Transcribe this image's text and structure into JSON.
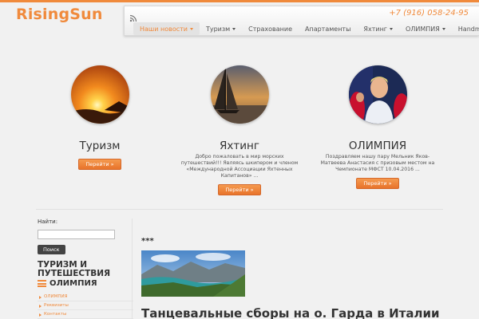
{
  "header": {
    "logo": "RisingSun",
    "phone": "+7 (916) 058-24-95",
    "accent_color": "#f08a3c",
    "icons": [
      "rss-icon"
    ]
  },
  "nav": {
    "items": [
      {
        "label": "Наши новости",
        "dropdown": true,
        "active": true
      },
      {
        "label": "Туризм",
        "dropdown": true,
        "active": false
      },
      {
        "label": "Страхование",
        "dropdown": false,
        "active": false
      },
      {
        "label": "Апартаменты",
        "dropdown": false,
        "active": false
      },
      {
        "label": "Яхтинг",
        "dropdown": true,
        "active": false
      },
      {
        "label": "ОЛИМПИЯ",
        "dropdown": true,
        "active": false
      },
      {
        "label": "Handmade",
        "dropdown": true,
        "active": false
      }
    ]
  },
  "features": [
    {
      "title": "Туризм",
      "text": "",
      "button": "Перейти »",
      "image": "sunset-photo"
    },
    {
      "title": "Яхтинг",
      "text": "Добро пожаловать в мир морских путешествий!!! Являясь шкипером и членом «Международной Ассоциации Яхтенных Капитанов» ...",
      "button": "Перейти »",
      "image": "sailboat-photo"
    },
    {
      "title": "ОЛИМПИЯ",
      "text": "Поздравляем нашу пару Мельник Яков-Матвеева Анастасия с призовым  местом на Чемпионате МФСТ 10.04.2016 ...",
      "button": "Перейти »",
      "image": "dancers-photo"
    }
  ],
  "sidebar": {
    "search_label": "Найти:",
    "search_value": "",
    "search_button": "Поиск",
    "heading": "ТУРИЗМ И ПУТЕШЕСТВИЯ",
    "subheading": "ОЛИМПИЯ",
    "links": [
      "ОЛИМПИЯ",
      "Реквизиты",
      "Контакты"
    ]
  },
  "post": {
    "stars": "***",
    "title": "Танцевальные сборы на о. Гарда в Италии",
    "image": "lake-landscape-photo"
  }
}
